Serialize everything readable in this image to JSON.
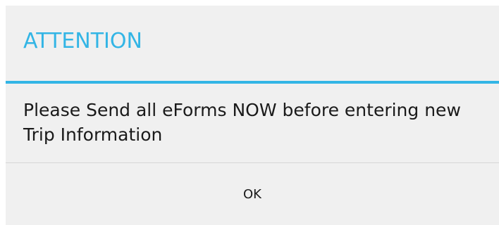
{
  "dialog": {
    "title": "ATTENTION",
    "message": "Please Send all eForms NOW before entering new Trip Information",
    "ok_label": "OK"
  },
  "colors": {
    "accent": "#33b5e5",
    "background": "#f0f0f0",
    "text": "#1a1a1a"
  }
}
